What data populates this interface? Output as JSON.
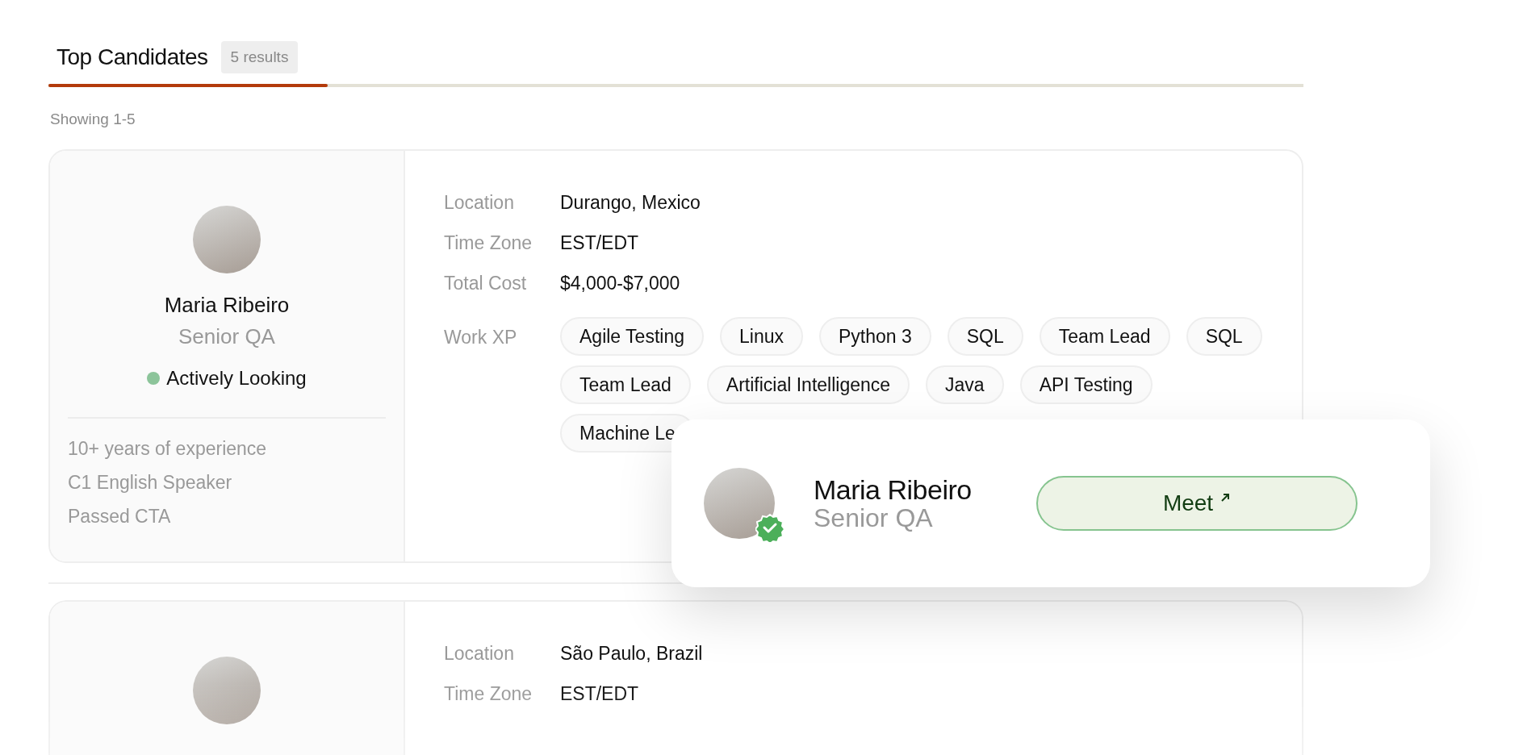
{
  "tabs": [
    {
      "label": "Top Candidates",
      "badge": "5 results",
      "selected": true
    }
  ],
  "showing": "Showing 1-5",
  "candidates": [
    {
      "name": "Maria Ribeiro",
      "role": "Senior QA",
      "status": {
        "label": "Actively Looking",
        "color": "#8cc49a"
      },
      "highlights": [
        "10+ years of experience",
        "C1 English Speaker",
        "Passed CTA"
      ],
      "details": [
        {
          "label": "Location",
          "value": "Durango, Mexico"
        },
        {
          "label": "Time Zone",
          "value": "EST/EDT"
        },
        {
          "label": "Total Cost",
          "value": "$4,000-$7,000"
        }
      ],
      "skills_label": "Work XP",
      "skills": [
        "Agile Testing",
        "Linux",
        "Python 3",
        "SQL",
        "Team Lead",
        "SQL",
        "Team Lead",
        "Artificial Intelligence",
        "Java",
        "API Testing",
        "Machine Le"
      ]
    },
    {
      "details": [
        {
          "label": "Location",
          "value": "São Paulo, Brazil"
        },
        {
          "label": "Time Zone",
          "value": "EST/EDT"
        }
      ]
    }
  ],
  "popup": {
    "name": "Maria Ribeiro",
    "role": "Senior QA",
    "verified": true,
    "button": "Meet"
  }
}
